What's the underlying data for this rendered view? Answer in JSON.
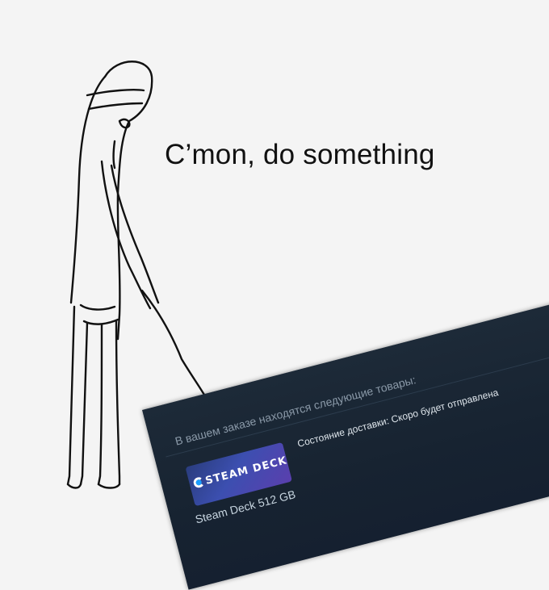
{
  "meme": {
    "caption": "C’mon, do something"
  },
  "steam_order": {
    "header": "В вашем заказе находятся следующие товары:",
    "delivery_status": "Состояние доставки: Скоро будет отправлена",
    "item_name": "Steam Deck 512 GB",
    "thumbnail_logo": "STEAM DECK"
  },
  "colors": {
    "card_background": "#1b2838",
    "text_muted": "#8a99a8",
    "text": "#c6d4df",
    "thumb_gradient_start": "#2a3d7e",
    "thumb_gradient_end": "#5a3fae",
    "steam_blue": "#1a9fff"
  }
}
